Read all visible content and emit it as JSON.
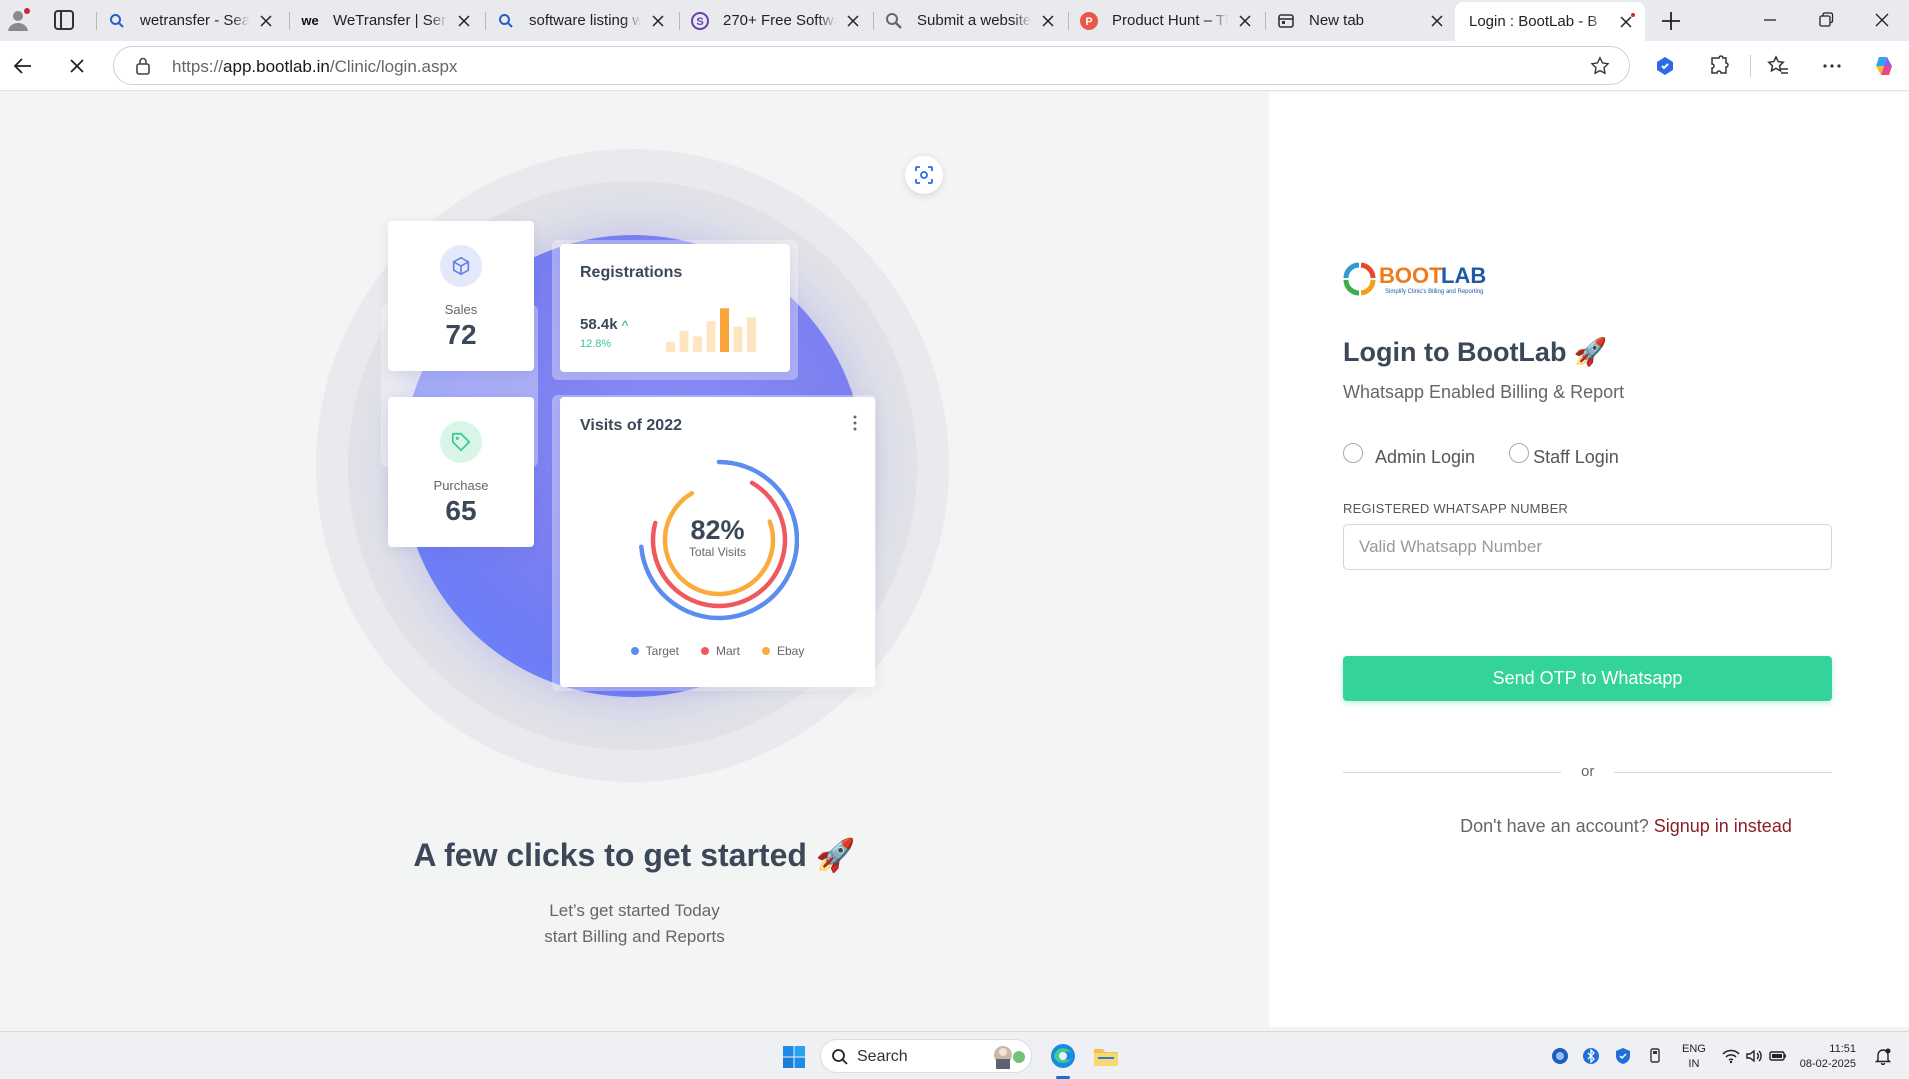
{
  "browser": {
    "tabs": [
      {
        "title": "wetransfer - Search",
        "icon": "search-icon"
      },
      {
        "title": "WeTransfer | Send",
        "icon": "wetransfer-icon"
      },
      {
        "title": "software listing websites",
        "icon": "search-icon"
      },
      {
        "title": "270+ Free Software",
        "icon": "s-logo-icon"
      },
      {
        "title": "Submit a website -",
        "icon": "magnifier-icon"
      },
      {
        "title": "Product Hunt – The",
        "icon": "producthunt-icon"
      },
      {
        "title": "New tab",
        "icon": "newtab-icon"
      },
      {
        "title": "Login : BootLab - B",
        "icon": "bootlab-favicon",
        "active": true
      }
    ],
    "url_prefix": "https://",
    "url_host": "app.bootlab.in",
    "url_path": "/Clinic/login.aspx"
  },
  "left": {
    "sales_card": {
      "label": "Sales",
      "value": "72"
    },
    "purchase_card": {
      "label": "Purchase",
      "value": "65"
    },
    "registrations_card": {
      "title": "Registrations",
      "value": "58.4k",
      "trend": "12.8%",
      "bar_values": [
        0.18,
        0.38,
        0.28,
        0.55,
        0.78,
        0.45,
        0.62
      ],
      "highlight_index": 4
    },
    "visits_card": {
      "title": "Visits of 2022",
      "percent": "82%",
      "subtitle": "Total Visits",
      "legend": [
        {
          "name": "Target",
          "color": "#5b8def"
        },
        {
          "name": "Mart",
          "color": "#f0585f"
        },
        {
          "name": "Ebay",
          "color": "#fbab3c"
        }
      ]
    },
    "hero_title": "A few clicks to get started 🚀",
    "hero_line1": "Let’s get started Today",
    "hero_line2": "start Billing and Reports"
  },
  "login": {
    "logo_text": "BOOTLAB",
    "logo_tagline": "Simplify Clinic's Billing and Reporting",
    "title": "Login to BootLab 🚀",
    "subtitle": "Whatsapp Enabled Billing & Report",
    "radio_admin": "Admin Login",
    "radio_staff": "Staff Login",
    "field_label": "REGISTERED WHATSAPP NUMBER",
    "field_placeholder": "Valid Whatsapp Number",
    "submit_label": "Send OTP to Whatsapp",
    "divider_text": "or",
    "signup_prompt": "Don't have an account?",
    "signup_link": "Signup in instead"
  },
  "taskbar": {
    "search_label": "Search",
    "lang_line1": "ENG",
    "lang_line2": "IN",
    "time": "11:51",
    "date": "08-02-2025"
  },
  "colors": {
    "accent_green": "#34d399",
    "link_red": "#8b1f28",
    "blob_purple": "#7c7ff0"
  }
}
